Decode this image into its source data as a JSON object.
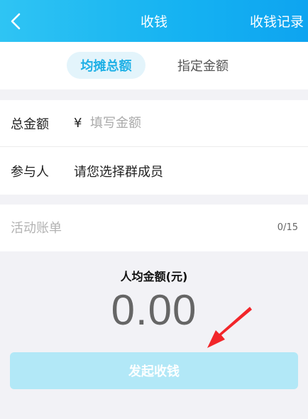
{
  "header": {
    "title": "收钱",
    "action_label": "收钱记录",
    "back_icon": "chevron-left-icon"
  },
  "tabs": [
    {
      "label": "均摊总额",
      "active": true
    },
    {
      "label": "指定金额",
      "active": false
    }
  ],
  "form": {
    "total_label": "总金额",
    "currency_symbol": "¥",
    "amount_placeholder": "填写金额",
    "participants_label": "参与人",
    "participants_value": "请您选择群成员"
  },
  "bill": {
    "placeholder": "活动账单",
    "count": "0/15"
  },
  "average": {
    "label": "人均金额(元)",
    "value": "0.00"
  },
  "submit": {
    "label": "发起收钱"
  },
  "colors": {
    "header_gradient_start": "#2fc4f3",
    "header_gradient_end": "#0ea4f0",
    "accent": "#1eb0e6",
    "button_disabled": "#b2e8f7",
    "annotation_arrow": "#f2262a"
  }
}
